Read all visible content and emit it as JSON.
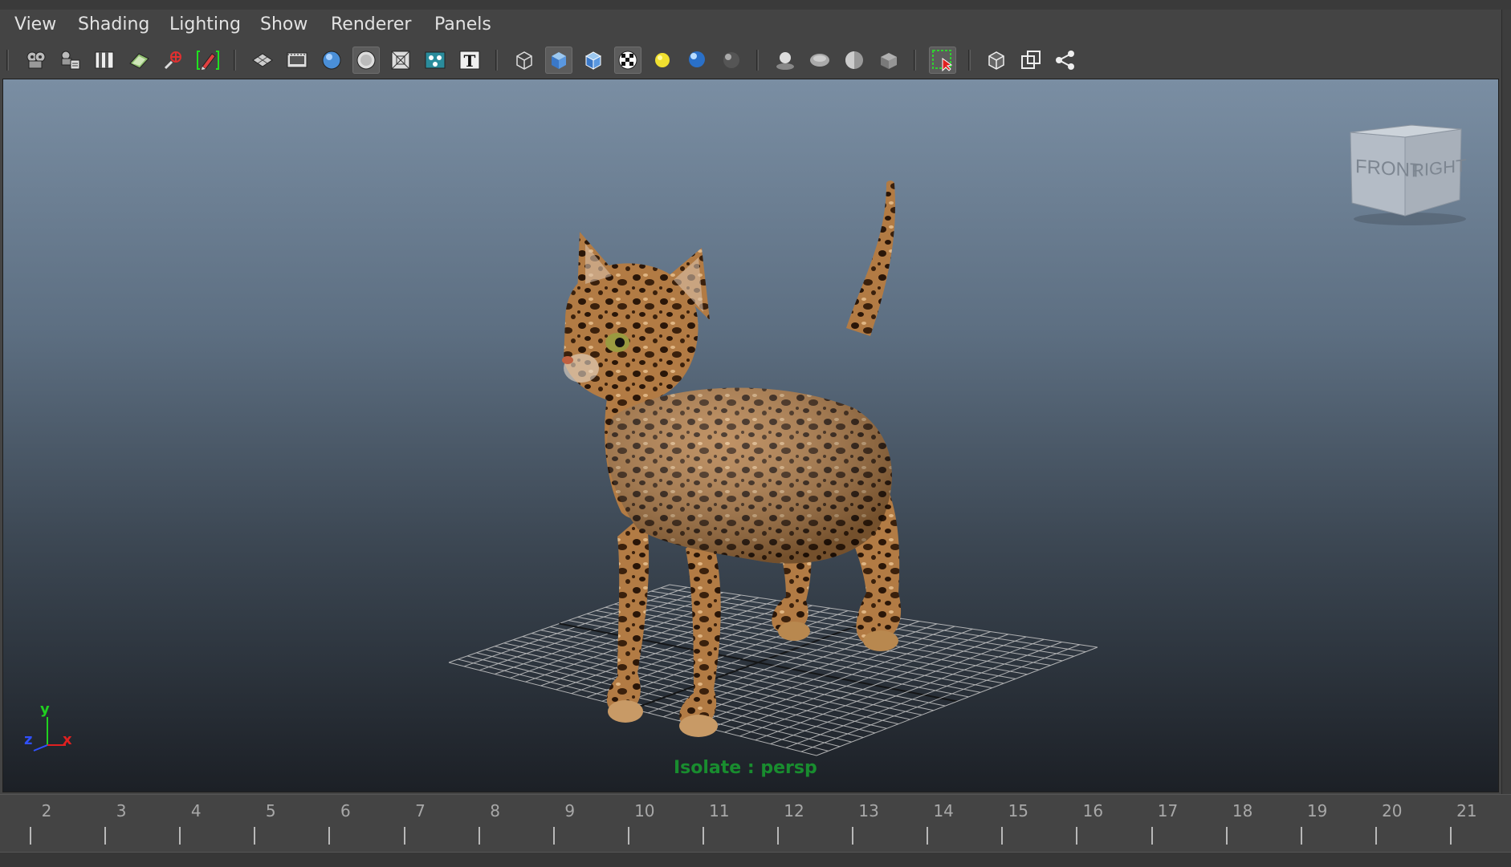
{
  "menu": [
    "View",
    "Shading",
    "Lighting",
    "Show",
    "Renderer",
    "Panels"
  ],
  "toolbar_icons": [
    "select-camera-icon",
    "camera-attributes-icon",
    "bookmarks-icon",
    "image-plane-icon",
    "camera-2d-pan-icon",
    "grease-pencil-icon",
    "grid-icon",
    "film-gate-icon",
    "resolution-gate-icon",
    "gate-mask-icon",
    "field-chart-icon",
    "safe-action-icon",
    "safe-title-icon",
    "wireframe-icon",
    "smooth-shade-icon",
    "wireframe-on-shaded-icon",
    "textured-icon",
    "use-all-lights-icon",
    "shadows-icon",
    "screen-space-ao-icon",
    "motion-blur-icon",
    "multisample-aa-icon",
    "depth-of-field-icon",
    "xray-icon",
    "isolate-select-icon",
    "xray-joints-icon",
    "xray-active-components-icon",
    "share-viewport-icon"
  ],
  "viewcube": {
    "front_label": "FRONT",
    "right_label": "RIGHT"
  },
  "axis": {
    "x": "x",
    "y": "y",
    "z": "z"
  },
  "isolate_label": "Isolate : persp",
  "timeline": {
    "labels": [
      "2",
      "3",
      "4",
      "5",
      "6",
      "7",
      "8",
      "9",
      "10",
      "11",
      "12",
      "13",
      "14",
      "15",
      "16",
      "17",
      "18",
      "19",
      "20",
      "21"
    ]
  },
  "colors": {
    "isolate_text": "#18a030",
    "axis_x": "#e02020",
    "axis_y": "#20d020",
    "axis_z": "#3050ff"
  }
}
